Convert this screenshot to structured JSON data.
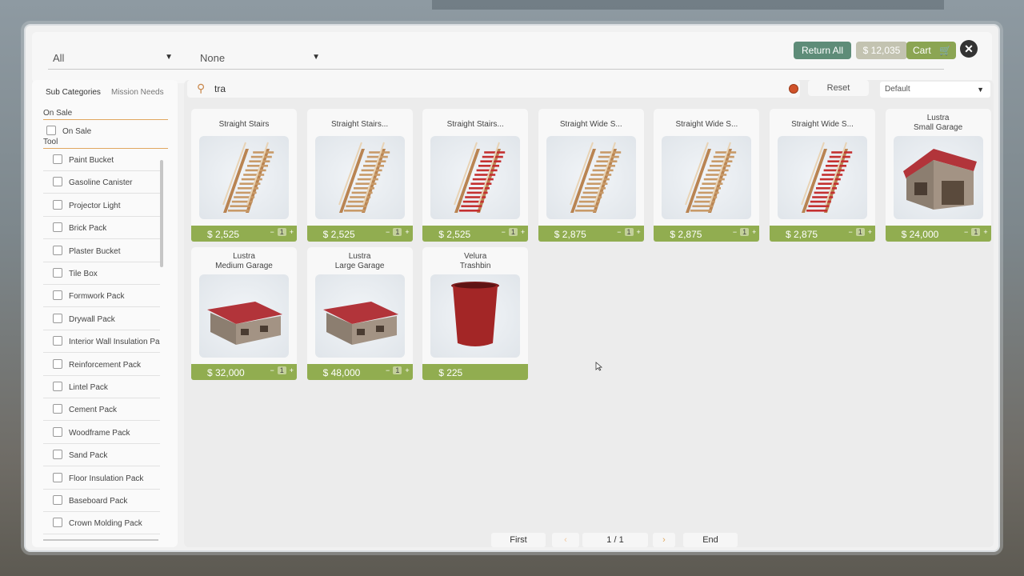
{
  "topbar": {
    "category_dropdown": "All",
    "subcategory_dropdown": "None",
    "return_all_label": "Return All",
    "money": "$ 12,035",
    "cart_label": "Cart",
    "close_glyph": "✕"
  },
  "sidebar": {
    "tabs": [
      "Sub Categories",
      "Mission Needs"
    ],
    "sections": {
      "on_sale": {
        "title": "On Sale",
        "items": [
          "On Sale"
        ]
      },
      "tool": {
        "title": "Tool",
        "items": [
          "Paint Bucket",
          "Gasoline Canister",
          "Projector Light",
          "Brick Pack",
          "Plaster Bucket",
          "Tile Box",
          "Formwork Pack",
          "Drywall Pack",
          "Interior Wall Insulation Pa",
          "Reinforcement Pack",
          "Lintel Pack",
          "Cement Pack",
          "Woodframe Pack",
          "Sand Pack",
          "Floor Insulation Pack",
          "Baseboard Pack",
          "Crown Molding Pack"
        ]
      }
    }
  },
  "search": {
    "query": "tra",
    "icon": "search-icon"
  },
  "reset_label": "Reset",
  "sort_value": "Default",
  "products": [
    {
      "title": "Straight Stairs",
      "price": "$ 2,525",
      "qty": "1",
      "kind": "stairs-wood"
    },
    {
      "title": "Straight Stairs...",
      "price": "$ 2,525",
      "qty": "1",
      "kind": "stairs-wood"
    },
    {
      "title": "Straight Stairs...",
      "price": "$ 2,525",
      "qty": "1",
      "kind": "stairs-red"
    },
    {
      "title": "Straight Wide S...",
      "price": "$ 2,875",
      "qty": "1",
      "kind": "stairs-wood"
    },
    {
      "title": "Straight Wide S...",
      "price": "$ 2,875",
      "qty": "1",
      "kind": "stairs-wood"
    },
    {
      "title": "Straight Wide S...",
      "price": "$ 2,875",
      "qty": "1",
      "kind": "stairs-red"
    },
    {
      "title": "Lustra\nSmall Garage",
      "price": "$ 24,000",
      "qty": "1",
      "kind": "garage-small"
    },
    {
      "title": "Lustra\nMedium Garage",
      "price": "$ 32,000",
      "qty": "1",
      "kind": "garage-wide"
    },
    {
      "title": "Lustra\nLarge Garage",
      "price": "$ 48,000",
      "qty": "1",
      "kind": "garage-wide"
    },
    {
      "title": "Velura\nTrashbin",
      "price": "$ 225",
      "qty": "",
      "kind": "trashbin"
    }
  ],
  "pager": {
    "first": "First",
    "prev": "‹",
    "current": "1 / 1",
    "next": "›",
    "end": "End"
  },
  "colors": {
    "price_bar": "#91ad50",
    "return_all": "#5e8c78",
    "cart": "#8ba553",
    "accent": "#e0a860"
  }
}
